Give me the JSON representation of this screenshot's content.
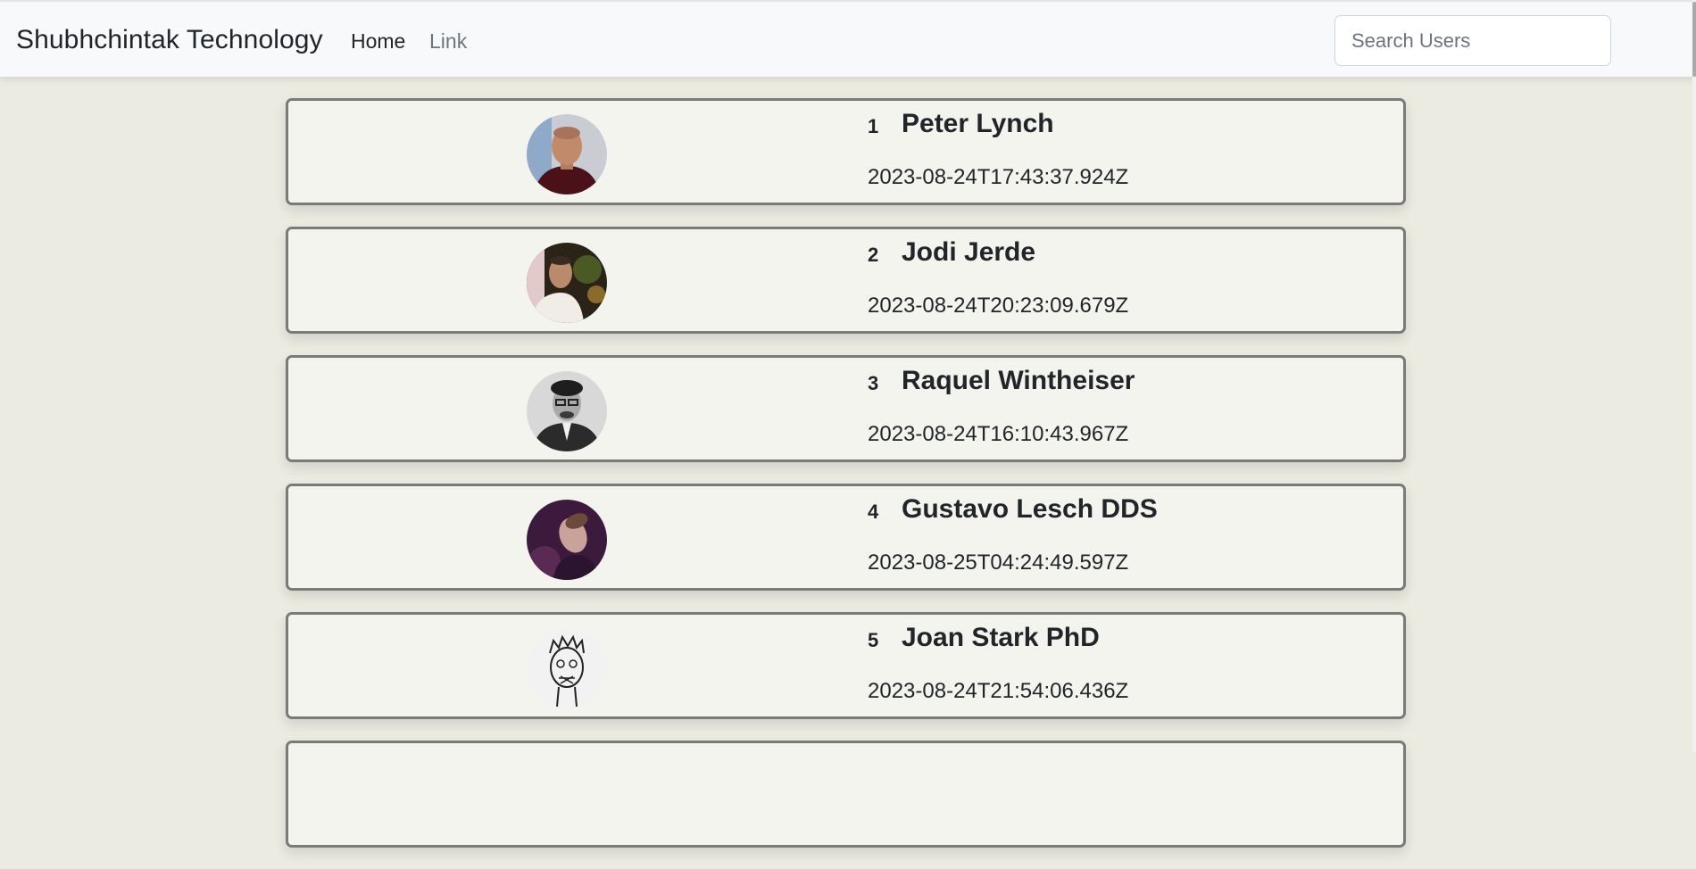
{
  "navbar": {
    "brand": "Shubhchintak Technology",
    "links": [
      {
        "label": "Home"
      },
      {
        "label": "Link"
      }
    ],
    "search": {
      "placeholder": "Search Users",
      "value": ""
    }
  },
  "users": [
    {
      "index": "1",
      "name": "Peter Lynch",
      "created_at": "2023-08-24T17:43:37.924Z"
    },
    {
      "index": "2",
      "name": "Jodi Jerde",
      "created_at": "2023-08-24T20:23:09.679Z"
    },
    {
      "index": "3",
      "name": "Raquel Wintheiser",
      "created_at": "2023-08-24T16:10:43.967Z"
    },
    {
      "index": "4",
      "name": "Gustavo Lesch DDS",
      "created_at": "2023-08-25T04:24:49.597Z"
    },
    {
      "index": "5",
      "name": "Joan Stark PhD",
      "created_at": "2023-08-24T21:54:06.436Z"
    },
    {
      "index": "",
      "name": "",
      "created_at": ""
    }
  ]
}
